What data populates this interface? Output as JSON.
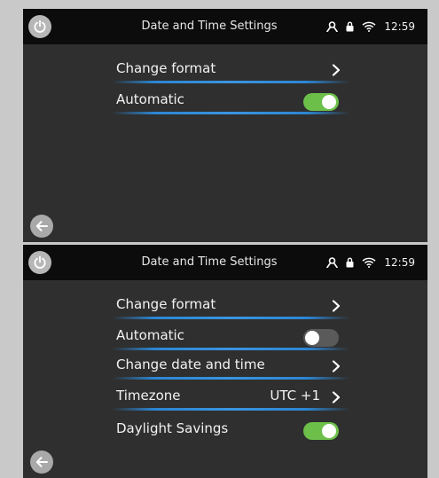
{
  "screens": [
    {
      "title": "Date and Time Settings",
      "clock": "12:59",
      "rows": {
        "change_format": {
          "label": "Change format"
        },
        "automatic": {
          "label": "Automatic",
          "toggle": "on"
        }
      }
    },
    {
      "title": "Date and Time Settings",
      "clock": "12:59",
      "rows": {
        "change_format": {
          "label": "Change format"
        },
        "automatic": {
          "label": "Automatic",
          "toggle": "off"
        },
        "change_date_time": {
          "label": "Change date and time"
        },
        "timezone": {
          "label": "Timezone",
          "value": "UTC +1"
        },
        "daylight": {
          "label": "Daylight Savings",
          "toggle": "on"
        }
      }
    }
  ],
  "icons": {
    "power": "power-icon",
    "user": "user-icon",
    "lock": "lock-icon",
    "wifi": "wifi-icon",
    "chevron": "chevron-right-icon",
    "back": "arrow-left-icon"
  },
  "colors": {
    "background": "#2f2f2f",
    "statusbar": "#0c0c0c",
    "divider": "#2c86d3",
    "toggle_on": "#6cc04a",
    "toggle_off": "#5a5a5a"
  }
}
